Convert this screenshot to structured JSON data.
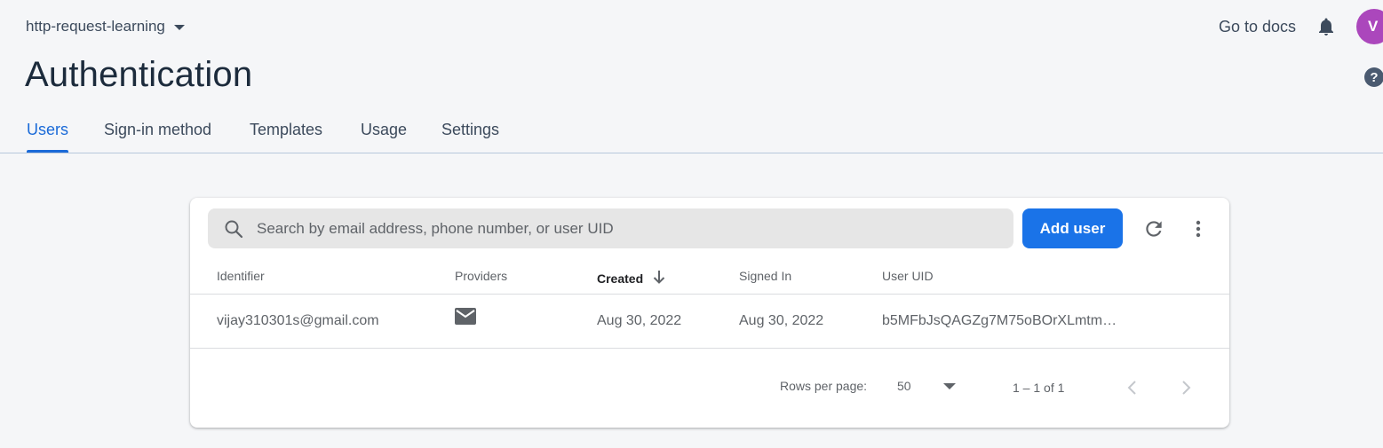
{
  "header": {
    "project_name": "http-request-learning",
    "docs_label": "Go to docs",
    "avatar_initial": "V",
    "page_title": "Authentication"
  },
  "tabs": [
    {
      "label": "Users",
      "active": true
    },
    {
      "label": "Sign-in method",
      "active": false
    },
    {
      "label": "Templates",
      "active": false
    },
    {
      "label": "Usage",
      "active": false
    },
    {
      "label": "Settings",
      "active": false
    }
  ],
  "toolbar": {
    "search_placeholder": "Search by email address, phone number, or user UID",
    "add_user_label": "Add user"
  },
  "table": {
    "columns": [
      "Identifier",
      "Providers",
      "Created",
      "Signed In",
      "User UID"
    ],
    "sorted_column": "Created",
    "sort_direction": "descending",
    "rows": [
      {
        "identifier": "vijay310301s@gmail.com",
        "provider_icon": "mail-icon",
        "created": "Aug 30, 2022",
        "signed_in": "Aug 30, 2022",
        "uid": "b5MFbJsQAGZg7M75oBOrXLmtm…"
      }
    ]
  },
  "pagination": {
    "rows_per_page_label": "Rows per page:",
    "rows_per_page_value": "50",
    "range_label": "1 – 1 of 1"
  },
  "colors": {
    "accent": "#1a73e8",
    "avatar": "#ab47bc",
    "background": "#f5f6f8"
  }
}
